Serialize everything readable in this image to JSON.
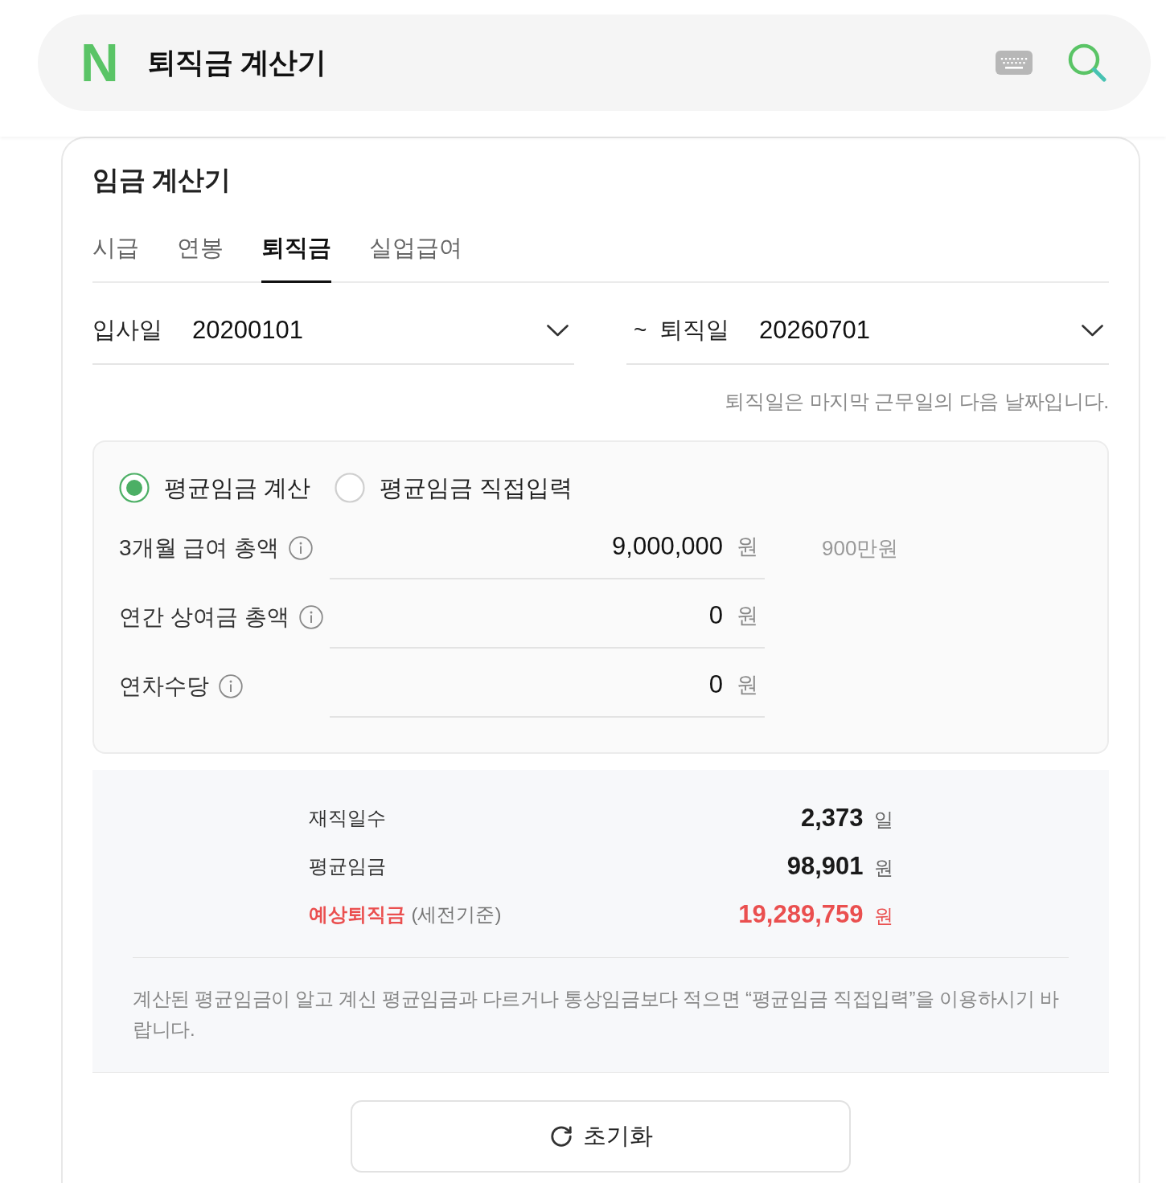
{
  "search": {
    "logo": "N",
    "query": "퇴직금 계산기"
  },
  "calculator": {
    "title": "임금 계산기",
    "tabs": [
      {
        "label": "시급",
        "selected": false
      },
      {
        "label": "연봉",
        "selected": false
      },
      {
        "label": "퇴직금",
        "selected": true
      },
      {
        "label": "실업급여",
        "selected": false
      }
    ]
  },
  "dates": [
    {
      "label": "입사일",
      "value": "20200101"
    },
    {
      "separator": "~",
      "label": "퇴직일",
      "value": "20260701"
    }
  ],
  "date_hint": "퇴직일은 마지막 근무일의 다음 날짜입니다.",
  "wage_mode": [
    {
      "label": "평균임금 계산",
      "selected": true
    },
    {
      "label": "평균임금 직접입력",
      "selected": false
    }
  ],
  "wage_inputs": [
    {
      "label": "3개월 급여 총액",
      "value": "9,000,000",
      "unit": "원",
      "reading": "900만원"
    },
    {
      "label": "연간 상여금 총액",
      "value": "0",
      "unit": "원"
    },
    {
      "label": "연차수당",
      "value": "0",
      "unit": "원"
    }
  ],
  "results": [
    {
      "label": "재직일수",
      "value": "2,373",
      "unit": "일",
      "highlighted": false
    },
    {
      "label": "평균임금",
      "value": "98,901",
      "unit": "원",
      "highlighted": false
    },
    {
      "label": "예상퇴직금",
      "note": "(세전기준)",
      "value": "19,289,759",
      "unit": "원",
      "highlighted": true
    }
  ],
  "notice": "계산된 평균임금이 알고 계신 평균임금과 다르거나 통상임금보다 적으면 “평균임금 직접입력”을 이용하시기 바랍니다.",
  "reset_button": {
    "label": "초기화"
  }
}
